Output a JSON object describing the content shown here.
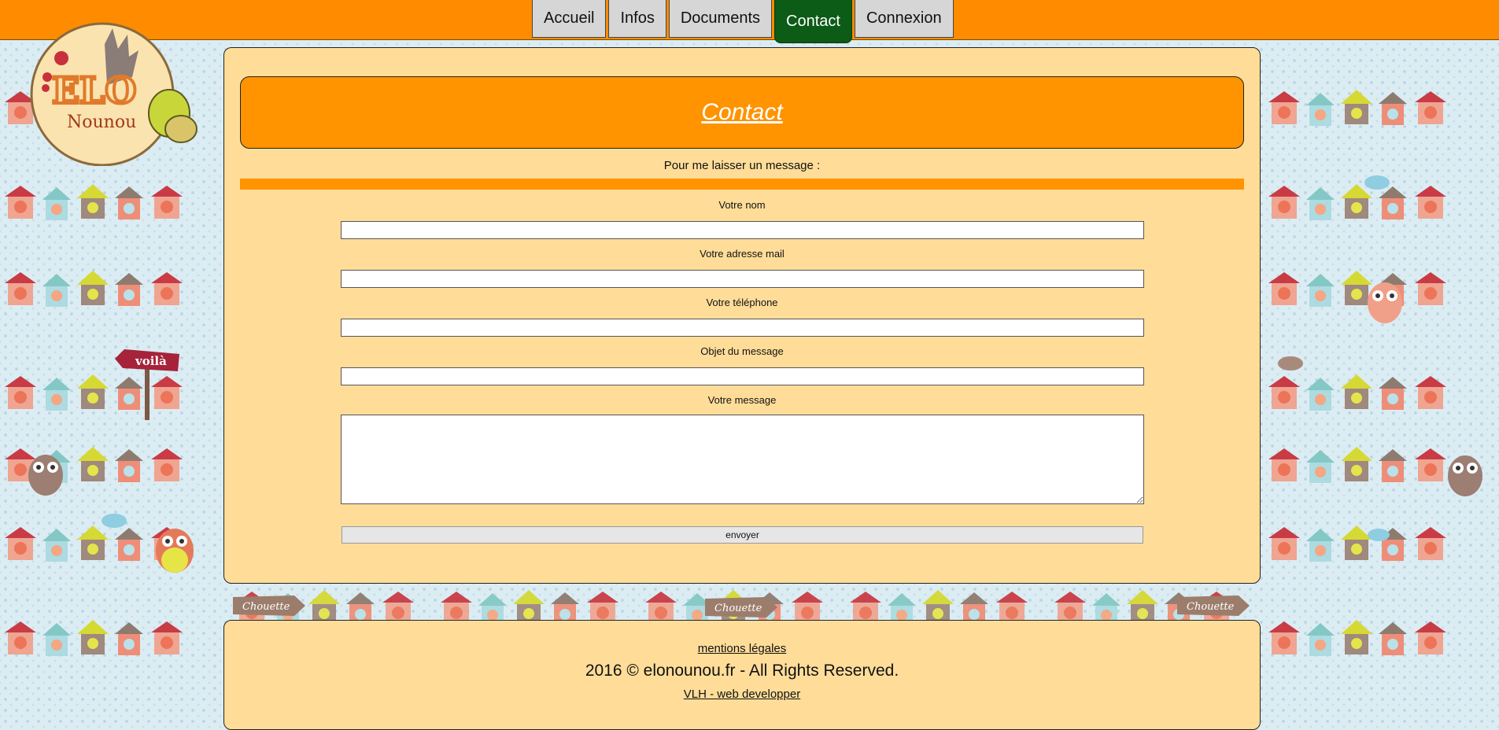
{
  "nav": {
    "items": [
      {
        "label": "Accueil"
      },
      {
        "label": "Infos"
      },
      {
        "label": "Documents"
      },
      {
        "label": "Contact"
      },
      {
        "label": "Connexion"
      }
    ],
    "active": "Contact"
  },
  "logo": {
    "text": "Nounou",
    "letters": "ELO"
  },
  "decor": {
    "sign_voila": "voilà",
    "sign_chouette": "Chouette"
  },
  "page": {
    "title": "Contact",
    "intro": "Pour me laisser un message :"
  },
  "form": {
    "name_label": "Votre nom",
    "name_value": "",
    "email_label": "Votre adresse mail",
    "email_value": "",
    "phone_label": "Votre téléphone",
    "phone_value": "",
    "subject_label": "Objet du message",
    "subject_value": "",
    "message_label": "Votre message",
    "message_value": "",
    "submit_label": "envoyer"
  },
  "footer": {
    "legal_link": "mentions légales",
    "copyright": "2016 © elonounou.fr - All Rights Reserved.",
    "developer_link": "VLH - web developper"
  },
  "colors": {
    "topbar": "#ff8c00",
    "panel": "#ffdd99",
    "header": "#ff9300",
    "nav_active": "#0c5b17",
    "nav_inactive": "#d6d6d6"
  }
}
